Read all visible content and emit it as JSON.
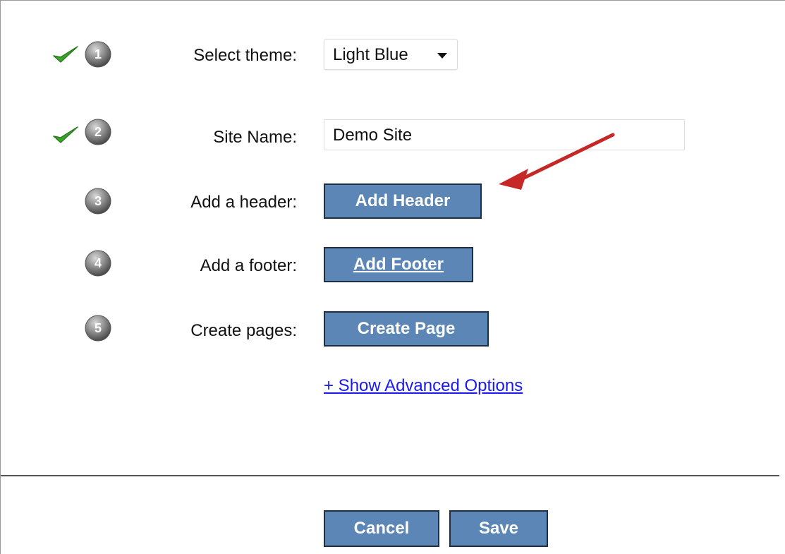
{
  "steps": [
    {
      "number": "1",
      "completed": true,
      "label": "Select theme:"
    },
    {
      "number": "2",
      "completed": true,
      "label": "Site Name:"
    },
    {
      "number": "3",
      "completed": false,
      "label": "Add a header:"
    },
    {
      "number": "4",
      "completed": false,
      "label": "Add a footer:"
    },
    {
      "number": "5",
      "completed": false,
      "label": "Create pages:"
    }
  ],
  "theme_select": {
    "value": "Light Blue"
  },
  "site_name_field": {
    "value": "Demo Site"
  },
  "buttons": {
    "add_header": "Add Header",
    "add_footer": "Add Footer",
    "create_page": "Create Page",
    "cancel": "Cancel",
    "save": "Save"
  },
  "advanced_link": "+ Show Advanced Options",
  "colors": {
    "button_bg": "#5b86b5",
    "button_border": "#1d2f44",
    "link": "#1a1aee",
    "check": "#3aa52b",
    "annotation_arrow": "#c62828"
  },
  "icons": {
    "check": "check-icon",
    "step": "step-number-icon",
    "annotation": "red-arrow-annotation",
    "dropdown": "chevron-down-icon"
  }
}
